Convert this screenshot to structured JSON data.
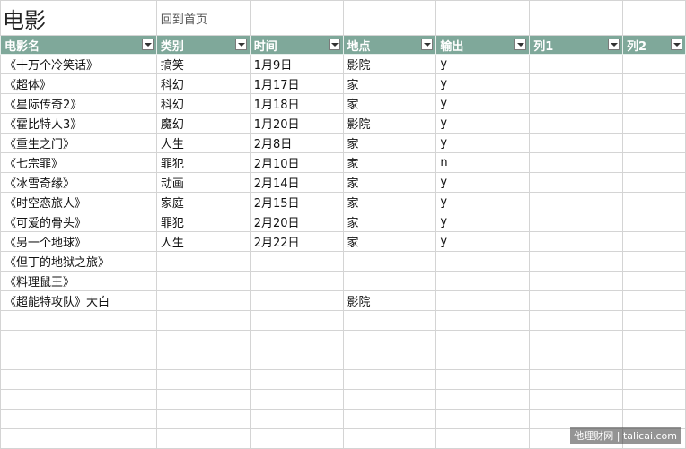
{
  "sheet": {
    "title": "电影",
    "home_link": "回到首页",
    "headers": [
      "电影名",
      "类别",
      "时间",
      "地点",
      "输出",
      "列1",
      "列2"
    ],
    "rows": [
      [
        "《十万个冷笑话》",
        "搞笑",
        "1月9日",
        "影院",
        "y",
        "",
        ""
      ],
      [
        "《超体》",
        "科幻",
        "1月17日",
        "家",
        "y",
        "",
        ""
      ],
      [
        "《星际传奇2》",
        "科幻",
        "1月18日",
        "家",
        "y",
        "",
        ""
      ],
      [
        "《霍比特人3》",
        "魔幻",
        "1月20日",
        "影院",
        "y",
        "",
        ""
      ],
      [
        "《重生之门》",
        "人生",
        "2月8日",
        "家",
        "y",
        "",
        ""
      ],
      [
        "《七宗罪》",
        "罪犯",
        "2月10日",
        "家",
        "n",
        "",
        ""
      ],
      [
        "《冰雪奇缘》",
        "动画",
        "2月14日",
        "家",
        "y",
        "",
        ""
      ],
      [
        "《时空恋旅人》",
        "家庭",
        "2月15日",
        "家",
        "y",
        "",
        ""
      ],
      [
        "《可爱的骨头》",
        "罪犯",
        "2月20日",
        "家",
        "y",
        "",
        ""
      ],
      [
        "《另一个地球》",
        "人生",
        "2月22日",
        "家",
        "y",
        "",
        ""
      ],
      [
        "《但丁的地狱之旅》",
        "",
        "",
        "",
        "",
        "",
        ""
      ],
      [
        "《料理鼠王》",
        "",
        "",
        "",
        "",
        "",
        ""
      ],
      [
        "《超能特攻队》大白",
        "",
        "",
        "影院",
        "",
        "",
        ""
      ],
      [
        "",
        "",
        "",
        "",
        "",
        "",
        ""
      ],
      [
        "",
        "",
        "",
        "",
        "",
        "",
        ""
      ],
      [
        "",
        "",
        "",
        "",
        "",
        "",
        ""
      ],
      [
        "",
        "",
        "",
        "",
        "",
        "",
        ""
      ],
      [
        "",
        "",
        "",
        "",
        "",
        "",
        ""
      ],
      [
        "",
        "",
        "",
        "",
        "",
        "",
        ""
      ],
      [
        "",
        "",
        "",
        "",
        "",
        "",
        ""
      ]
    ]
  },
  "watermark": "他理财网 | talicai.com",
  "colors": {
    "header_bg": "#7fa89a",
    "grid_line": "#d4d4d4"
  }
}
